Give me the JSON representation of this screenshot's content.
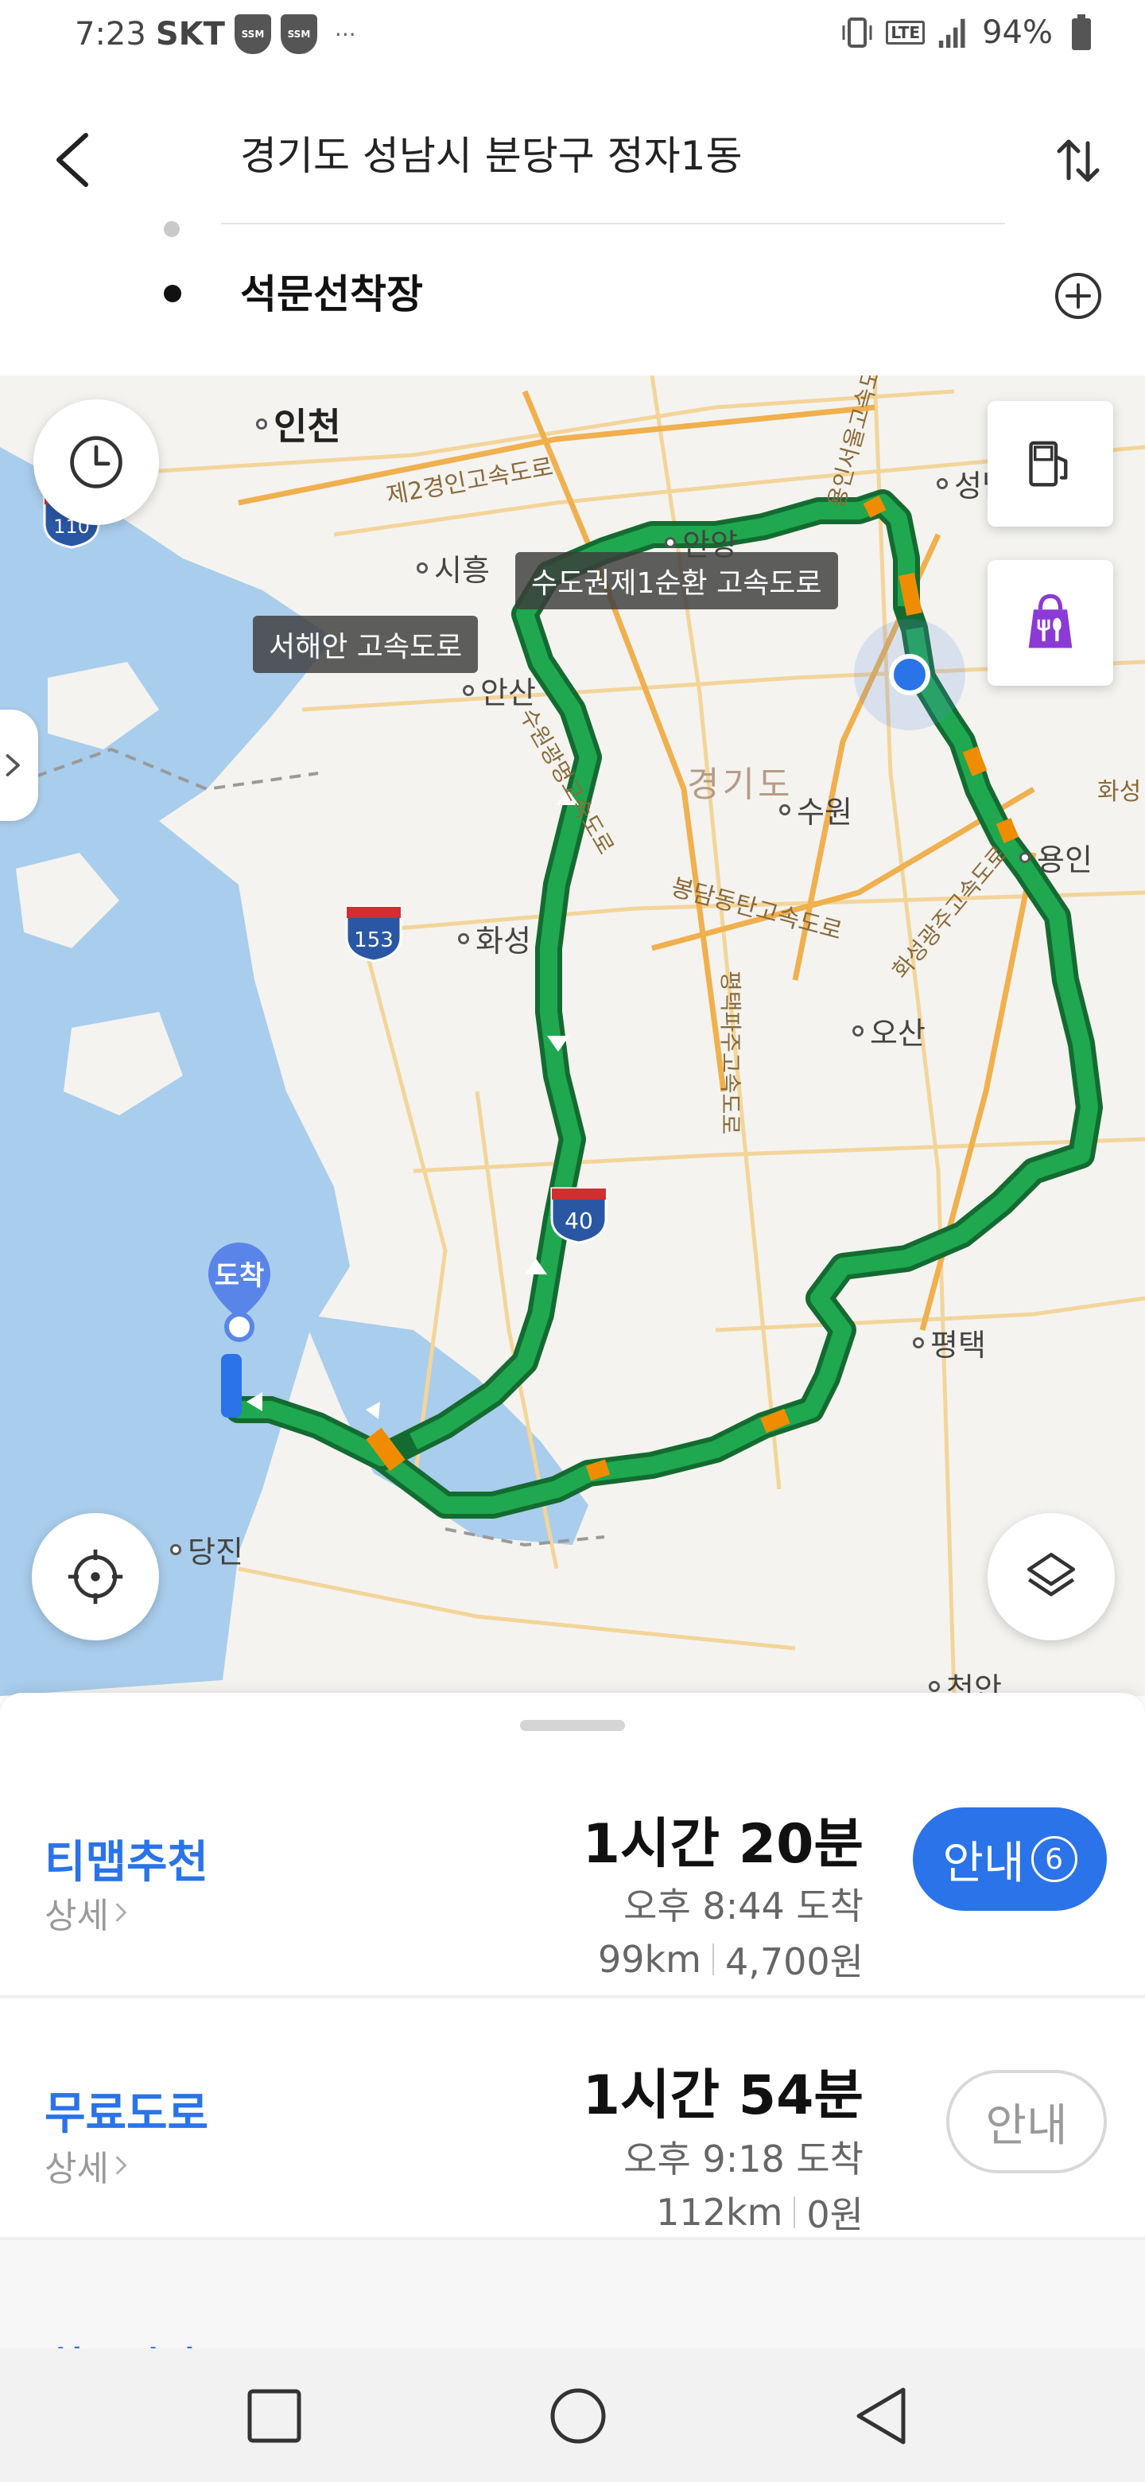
{
  "status_bar": {
    "time": "7:23",
    "carrier": "SKT",
    "badge_1": "SSM",
    "badge_2": "SSM",
    "more": "···",
    "network": "LTE",
    "battery": "94%"
  },
  "route": {
    "origin": "경기도 성남시 분당구 정자1동",
    "destination": "석문선착장"
  },
  "map": {
    "road_labels": {
      "label_1": "수도권제1순환 고속도로",
      "label_2": "서해안 고속도로"
    },
    "cities": {
      "incheon": "인천",
      "siheung": "시흥",
      "anyang": "안양",
      "ansan": "안산",
      "suwon": "수원",
      "yongin": "용인",
      "hwaseong": "화성",
      "osan": "오산",
      "pyeongtaek": "평택",
      "dangjin": "당진",
      "seongnam": "성남",
      "cheonan": "천안"
    },
    "region": "경기도",
    "road_names": {
      "r1": "제2경인고속도로",
      "r2": "수원광명고속도로",
      "r3": "용인서울고속도로",
      "r4": "봉담동탄고속도로",
      "r5": "화성광주고속도로",
      "r6": "평택파주고속도로",
      "r7": "화성"
    },
    "shields": {
      "s153": "153",
      "s40": "40",
      "s110": "110"
    },
    "arrival_pin": "도착",
    "colors": {
      "route_green": "#1fa84f",
      "route_orange": "#f08c00",
      "water": "#a9cdec",
      "land": "#f4f3ef"
    }
  },
  "options": [
    {
      "name": "티맵추천",
      "detail": "상세",
      "duration": "1시간 20분",
      "arrival": "오후 8:44 도착",
      "distance": "99km",
      "fee": "4,700원",
      "guide_label": "안내",
      "guide_count": "6"
    },
    {
      "name": "무료도로",
      "detail": "상세",
      "duration": "1시간 54분",
      "arrival": "오후 9:18 도착",
      "distance": "112km",
      "fee": "0원",
      "guide_label": "안내"
    }
  ],
  "more_option_partial": "최소시간",
  "icons": {
    "back": "back-arrow-icon",
    "swap": "swap-icon",
    "add": "add-waypoint-icon",
    "history": "clock-icon",
    "gas": "gas-station-icon",
    "food": "restaurant-icon",
    "locate": "gps-locate-icon",
    "layers": "layers-icon"
  }
}
